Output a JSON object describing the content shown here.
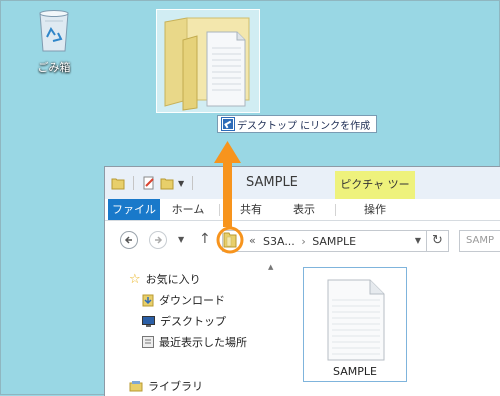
{
  "desktop": {
    "recycle_bin_label": "ごみ箱",
    "drag_tooltip": "デスクトップ にリンクを作成"
  },
  "window": {
    "title": "SAMPLE",
    "contextual_tab_group": "ピクチャ ツール",
    "ribbon_tabs": {
      "file": "ファイル",
      "home": "ホーム",
      "share": "共有",
      "view": "表示",
      "manage": "操作"
    },
    "address": {
      "breadcrumb_prefix": "«",
      "segment_1": "S3A...",
      "separator": "›",
      "segment_2": "SAMPLE"
    },
    "search_placeholder": "SAMP",
    "nav": {
      "favorites": "お気に入り",
      "downloads": "ダウンロード",
      "desktop": "デスクトップ",
      "recent_places": "最近表示した場所",
      "libraries": "ライブラリ"
    },
    "files": [
      {
        "name": "SAMPLE"
      }
    ]
  },
  "colors": {
    "desktop_bg": "#99d7e4",
    "file_tab_bg": "#1979ca",
    "picture_tools_bg": "#eef27c",
    "highlight_orange": "#f7941d",
    "selection_border": "#7fb4dc"
  }
}
